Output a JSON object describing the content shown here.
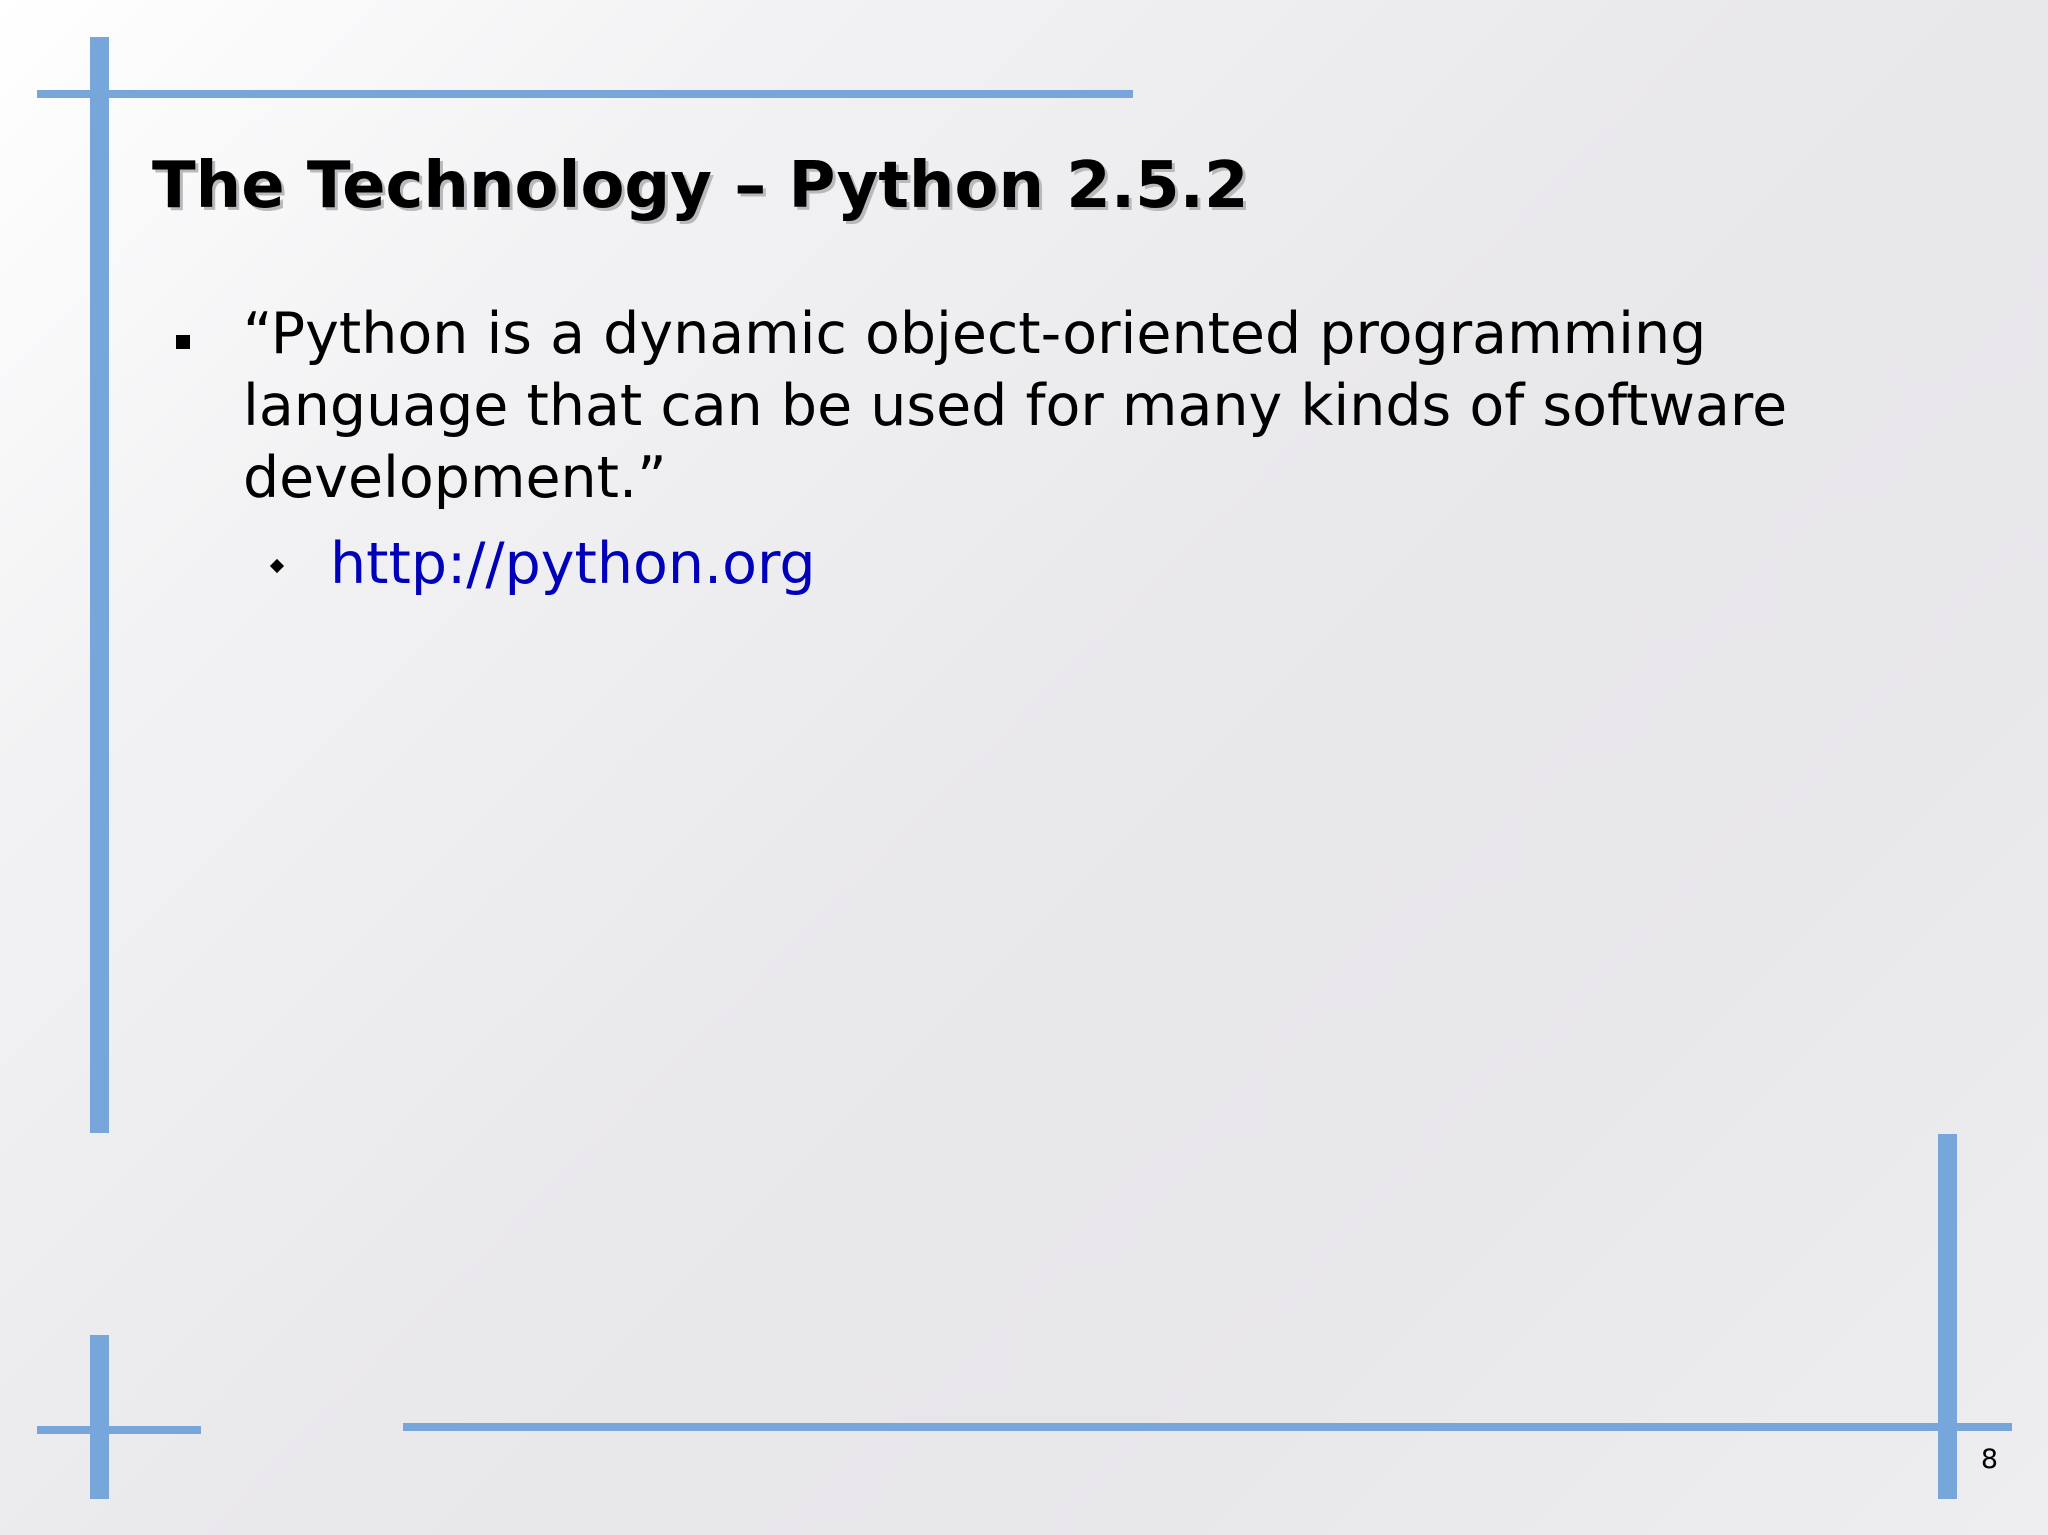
{
  "slide": {
    "title": "The Technology – Python 2.5.2",
    "bullets": [
      {
        "line1": "“Python is a dynamic object-oriented programming",
        "line2": "language that can be used for many kinds of software",
        "line3": "development.”",
        "sub_bullets": [
          {
            "text": "http://python.org"
          }
        ]
      }
    ],
    "page_number": "8"
  },
  "colors": {
    "accent_bars": "#77a6db",
    "link": "#0000bb",
    "text": "#000000"
  },
  "icons": {
    "main_bullet": "square-bullet-icon",
    "sub_bullet": "diamond-bullet-icon"
  }
}
